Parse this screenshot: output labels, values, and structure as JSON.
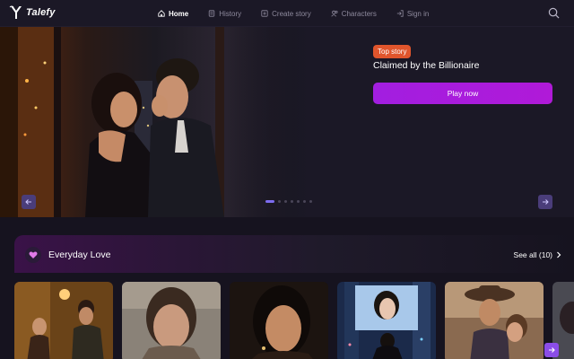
{
  "header": {
    "logo_text": "Talefy",
    "nav": [
      {
        "label": "Home",
        "icon": "home-icon",
        "active": true
      },
      {
        "label": "History",
        "icon": "history-icon",
        "active": false
      },
      {
        "label": "Create story",
        "icon": "plus-square-icon",
        "active": false
      },
      {
        "label": "Characters",
        "icon": "users-icon",
        "active": false
      },
      {
        "label": "Sign in",
        "icon": "sign-in-icon",
        "active": false
      }
    ],
    "search_icon": "search-icon"
  },
  "hero": {
    "badge": "Top story",
    "title": "Claimed by the Billionaire",
    "play_label": "Play now",
    "slide_count": 7,
    "active_slide": 1
  },
  "section": {
    "title": "Everyday Love",
    "see_all": "See all (10)",
    "icon": "heart-icon"
  },
  "cards": [
    {
      "name": "card-couple-warm-light"
    },
    {
      "name": "card-woman-portrait"
    },
    {
      "name": "card-woman-dark-hair"
    },
    {
      "name": "card-woman-billboard-city"
    },
    {
      "name": "card-cowboy-couple"
    },
    {
      "name": "card-partial"
    }
  ],
  "colors": {
    "accent": "#a21ee0",
    "badge": "#e0552c",
    "background": "#16131f",
    "header": "#1b1826"
  }
}
